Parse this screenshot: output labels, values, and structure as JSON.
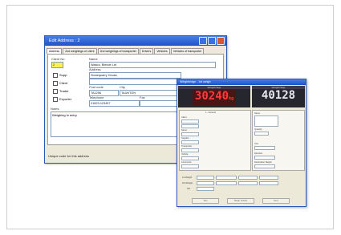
{
  "edit_address": {
    "title": "Edit Address : 2",
    "tabs": [
      "Address",
      "2nd weighings of client",
      "2nd weighings of transporter",
      "Drivers",
      "Vehicles",
      "Vehicles of transporter"
    ],
    "client_no_label": "Client No",
    "client_no_value": "2",
    "name_label": "Name",
    "name_value": "Waaco, Blende Ltd",
    "address_label": "Address",
    "address_value": "Stonequarry House,",
    "checkboxes": [
      "Supp.",
      "Client",
      "Trader",
      "Exporter"
    ],
    "postcode_label": "Post code",
    "postcode_value": "TA1256",
    "city_label": "City",
    "city_value": "TAUNTON",
    "telephone_label": "Telephone",
    "telephone_value": "01823-123457",
    "fax_label": "Fax",
    "notes_label": "Notes",
    "notes_value": "Weighing in entry",
    "status_text": "Unique code for this address",
    "help_glyph": "?"
  },
  "weighbridge": {
    "title": "Weighbridge - 1st weigh",
    "left_display_label": "Weighbridge",
    "left_value": "30240",
    "left_unit": "kg",
    "right_display_label": "Weighbridge",
    "right_value": "40128",
    "panel_title": "1 - Account",
    "form_labels": [
      "Client",
      "Address",
      "Name",
      "Supplier",
      "Transporter",
      "Vehicle",
      "Comments"
    ],
    "right_labels": [
      "Name",
      "Quantity",
      "Unit",
      "Direction",
      "Destination Weight"
    ],
    "weigh_labels": [
      "1st Weight",
      "2nd Weight",
      "Net"
    ],
    "buttons": [
      "Tare",
      "Weigh Vehicle",
      "Next"
    ]
  },
  "colors": {
    "titlebar": "#1f52c8",
    "display_bg": "#26262e",
    "digits_red": "#ff3a3a",
    "digits_white": "#e8e8f0",
    "client_field": "#ffee55"
  }
}
